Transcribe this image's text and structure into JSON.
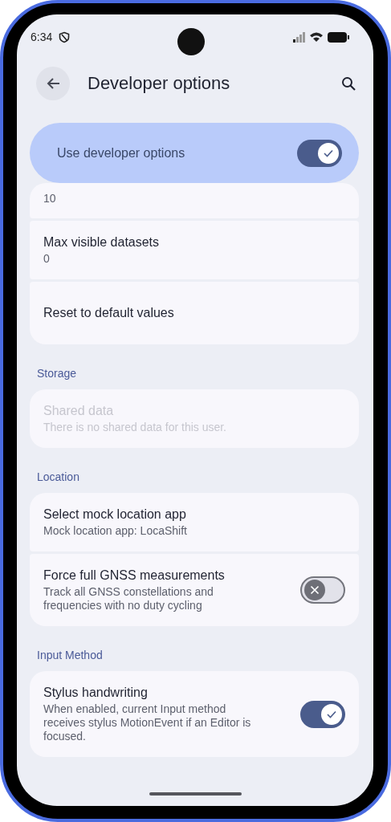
{
  "status_bar": {
    "time": "6:34"
  },
  "header": {
    "title": "Developer options"
  },
  "master_switch": {
    "label": "Use developer options",
    "on": true
  },
  "sections": [
    {
      "items": [
        {
          "kind": "value",
          "summary": "10",
          "disabled": false
        },
        {
          "kind": "value",
          "title": "Max visible datasets",
          "summary": "0",
          "disabled": false
        },
        {
          "kind": "action",
          "title": "Reset to default values",
          "disabled": false
        }
      ]
    },
    {
      "title": "Storage",
      "items": [
        {
          "kind": "value",
          "title": "Shared data",
          "summary": "There is no shared data for this user.",
          "disabled": true
        }
      ]
    },
    {
      "title": "Location",
      "items": [
        {
          "kind": "value",
          "title": "Select mock location app",
          "summary": "Mock location app: LocaShift",
          "disabled": false
        },
        {
          "kind": "switch",
          "title": "Force full GNSS measurements",
          "summary": "Track all GNSS constellations and frequencies with no duty cycling",
          "disabled": false,
          "on": false
        }
      ]
    },
    {
      "title": "Input Method",
      "items": [
        {
          "kind": "switch",
          "title": "Stylus handwriting",
          "summary": "When enabled, current Input method receives stylus MotionEvent if an Editor is focused.",
          "disabled": false,
          "on": true
        }
      ]
    }
  ]
}
